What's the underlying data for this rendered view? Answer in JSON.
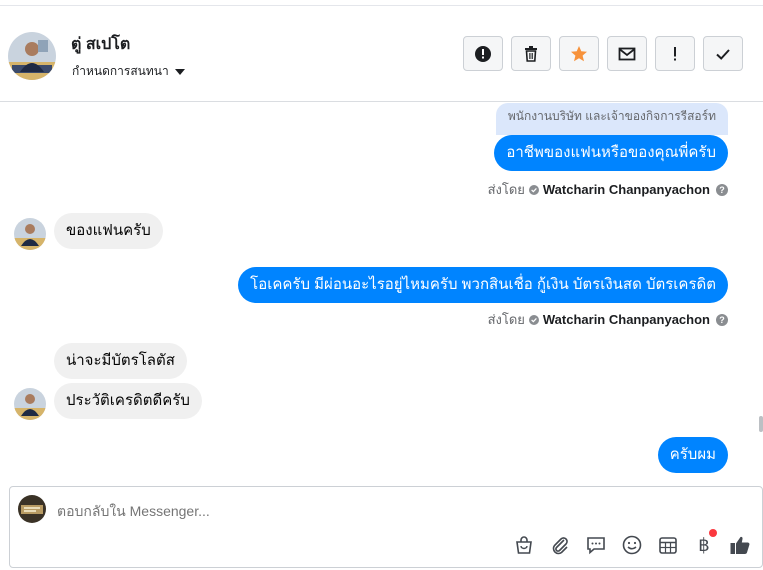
{
  "header": {
    "contact_name": "ตู่ สเปโต",
    "assign_label": "กำหนดการสนทนา"
  },
  "actions": [
    {
      "name": "mark-spam-button",
      "icon": "exclamation-circle-icon"
    },
    {
      "name": "delete-button",
      "icon": "trash-icon"
    },
    {
      "name": "star-button",
      "icon": "star-icon"
    },
    {
      "name": "mark-unread-button",
      "icon": "envelope-icon"
    },
    {
      "name": "follow-up-button",
      "icon": "exclamation-icon"
    },
    {
      "name": "mark-done-button",
      "icon": "checkmark-icon"
    }
  ],
  "thread": {
    "note_1": "พนักงานบริษัท และเจ้าของกิจการรีสอร์ท",
    "out_1": "อาชีพของแฟนหรือของคุณพี่ครับ",
    "sent_by_label": "ส่งโดย",
    "sent_by_name": "Watcharin Chanpanyachon",
    "in_1": "ของแฟนครับ",
    "out_2": "โอเคครับ มีผ่อนอะไรอยู่ไหมครับ พวกสินเชื่อ กู้เงิน บัตรเงินสด บัตรเครดิต",
    "in_2": "น่าจะมีบัตรโลตัส",
    "in_3": "ประวัติเครดิตดีครับ",
    "out_3": "ครับผม"
  },
  "composer": {
    "placeholder": "ตอบกลับใน Messenger..."
  },
  "tools": {
    "baht_symbol": "฿"
  },
  "colors": {
    "accent": "#0084ff",
    "star": "#f7923b",
    "badge": "#fa383e"
  }
}
